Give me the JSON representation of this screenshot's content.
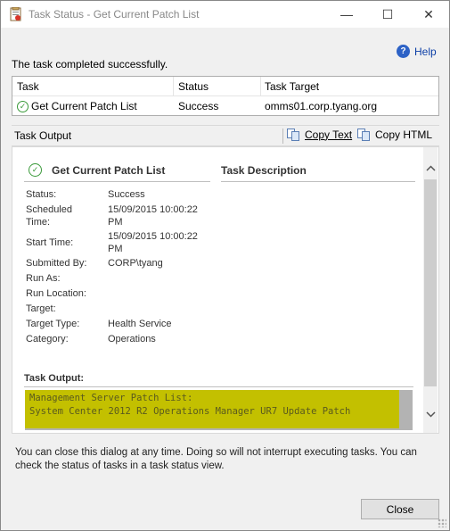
{
  "window": {
    "title": "Task Status - Get Current Patch List",
    "minimize": "—",
    "maximize": "☐",
    "close": "✕"
  },
  "help": {
    "label": "Help",
    "icon": "?"
  },
  "status_message": "The task completed successfully.",
  "task_list": {
    "headers": [
      "Task",
      "Status",
      "Task Target"
    ],
    "rows": [
      {
        "task": "Get Current Patch List",
        "status": "Success",
        "target": "omms01.corp.tyang.org"
      }
    ]
  },
  "toolbar": {
    "label": "Task Output",
    "copy_text": "Copy Text",
    "copy_html": "Copy HTML"
  },
  "details": {
    "task_name": "Get Current Patch List",
    "description_title": "Task Description",
    "properties": [
      {
        "label": "Status:",
        "value": "Success"
      },
      {
        "label": "Scheduled Time:",
        "value": "15/09/2015 10:00:22 PM"
      },
      {
        "label": "Start Time:",
        "value": "15/09/2015 10:00:22 PM"
      },
      {
        "label": "Submitted By:",
        "value": "CORP\\tyang"
      },
      {
        "label": "Run As:",
        "value": ""
      },
      {
        "label": "Run Location:",
        "value": ""
      },
      {
        "label": "Target:",
        "value": ""
      },
      {
        "label": "Target Type:",
        "value": "Health Service"
      },
      {
        "label": "Category:",
        "value": "Operations"
      }
    ],
    "output_title": "Task Output:",
    "output_lines": [
      "Management Server Patch List:",
      "System Center 2012 R2 Operations Manager UR7 Update Patch"
    ]
  },
  "footer_message": "You can close this dialog at any time. Doing so will not interrupt executing tasks. You can check the status of tasks in a task status view.",
  "close_button": "Close",
  "colors": {
    "highlight": "#c3c000",
    "success": "#3a9a3a",
    "link": "#0b3ea6"
  }
}
